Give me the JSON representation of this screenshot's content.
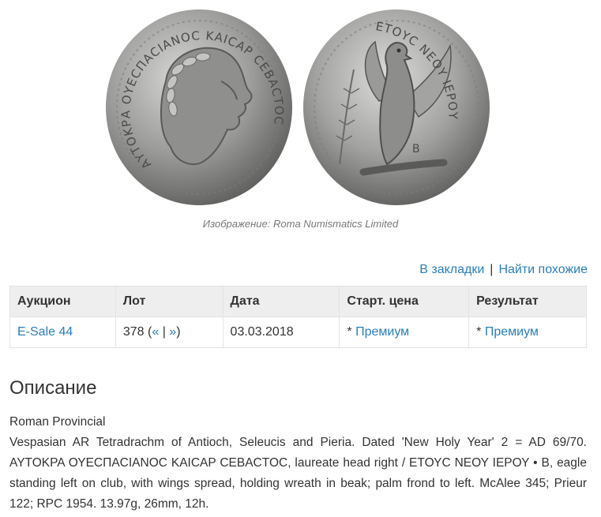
{
  "image": {
    "caption": "Изображение: Roma Numismatics Limited",
    "obverse_legend": "ΑΥΤΟΚΡΑ ΟΥΕϹΠΑϹΙΑΝΟϹ ΚΑΙϹΑΡ ϹΕΒΑϹΤΟϹ",
    "reverse_legend": "ΕΤΟΥϹ ΝΕΟΥ ΙΕΡΟΥ",
    "reverse_field": "Β"
  },
  "actions": {
    "bookmark": "В закладки",
    "separator": "|",
    "similar": "Найти похожие"
  },
  "table": {
    "headers": [
      "Аукцион",
      "Лот",
      "Дата",
      "Старт. цена",
      "Результат"
    ],
    "row": {
      "auction": "E-Sale 44",
      "lot_number": "378",
      "lot_prev": "«",
      "lot_sep": "|",
      "lot_next": "»",
      "date": "03.03.2018",
      "start_star": "*",
      "start_link": "Премиум",
      "result_star": "*",
      "result_link": "Премиум"
    }
  },
  "description": {
    "heading": "Описание",
    "category": "Roman Provincial",
    "text": "Vespasian AR Tetradrachm of Antioch, Seleucis and Pieria. Dated 'New Holy Year' 2 = AD 69/70. ΑΥΤΟΚΡΑ ΟΥΕϹΠΑϹΙΑΝΟϹ ΚΑΙϹΑΡ ϹΕΒΑϹΤΟϹ, laureate head right / ΕΤΟΥϹ ΝΕΟΥ ΙΕΡΟΥ • Β, eagle standing left on club, with wings spread, holding wreath in beak; palm frond to left. McAlee 345; Prieur 122; RPC 1954. 13.97g, 26mm, 12h."
  },
  "colors": {
    "link": "#2a7fb8",
    "text": "#333333",
    "header_bg": "#eeeeee",
    "border": "#e3e3e3",
    "caption": "#777777"
  }
}
